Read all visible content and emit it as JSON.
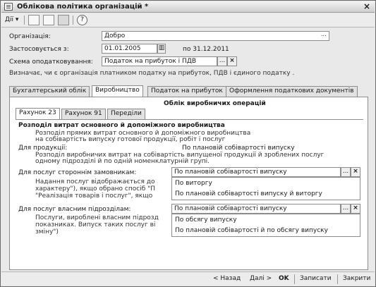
{
  "window": {
    "title": "Облікова політика організацій *",
    "close": "×"
  },
  "toolbar": {
    "actions_label": "Дії",
    "help_label": "?"
  },
  "form": {
    "org_label": "Організація:",
    "org_value": "Добро",
    "applies_label": "Застосовується з:",
    "applies_value": "01.01.2005",
    "until_text": "по 31.12.2011",
    "tax_label": "Схема оподатковування:",
    "tax_value": "Податок на прибуток і ПДВ",
    "hint": "Визначає, чи є організація платником податку на прибуток, ПДВ і єдиного податку ."
  },
  "tabs": [
    "Бухгалтерський облік",
    "Виробництво",
    "Податок на прибуток",
    "Оформлення податкових документів"
  ],
  "panel": {
    "title": "Облік виробничих операцій",
    "subtabs": [
      "Рахунок 23",
      "Рахунок 91",
      "Переділи"
    ],
    "section_title": "Розподіл витрат основного й допоміжного виробництва",
    "section_desc1": "Розподіл прямих витрат основного й допоміжного виробництва",
    "section_desc2": "на собівартість випуску готової продукції, робіт і послуг",
    "prod_label": "Для продукції:",
    "prod_value": "По плановій собівартості випуску",
    "prod_desc1": "Розподіл виробничих витрат на собівартість випущеної продукції й зроблених послуг",
    "prod_desc2": "одному підрозділі й по одній номенклатурній групі.",
    "ext_label": "Для послуг стороннім замовникам:",
    "ext_value": "По плановій собівартості випуску",
    "ext_desc1": "Надання послуг відображається до",
    "ext_desc2": "характеру\"), якщо обрано спосіб \"П",
    "ext_desc3": "\"Реалізація товарів і послуг\", якщо",
    "ext_options": [
      "По виторгу",
      "По плановій собівартості випуску й виторгу"
    ],
    "own_label": "Для послуг власним підрозділам:",
    "own_value": "По плановій собівартості випуску",
    "own_desc1": "Послуги, вироблені власним підрозд",
    "own_desc2": "показниках. Випуск таких послуг ві",
    "own_desc3": "зміну\")",
    "own_options": [
      "По обсягу випуску",
      "По плановій собівартості й по обсягу випуску"
    ]
  },
  "footer": {
    "back": "< Назад",
    "next": "Далі >",
    "ok": "OK",
    "save": "Записати",
    "close": "Закрити"
  }
}
